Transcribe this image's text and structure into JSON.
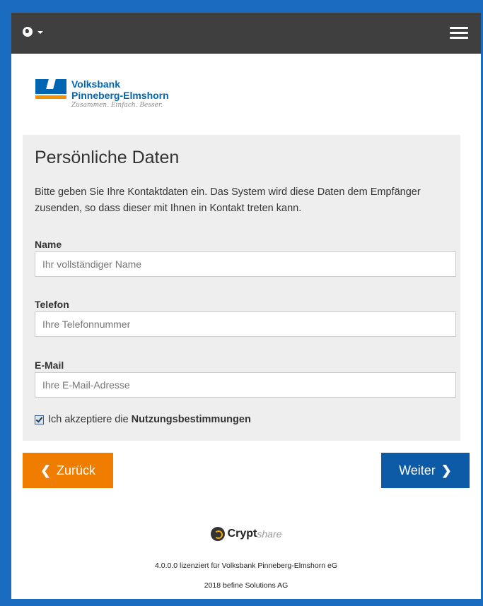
{
  "header": {
    "language_icon": "globe-icon",
    "menu_icon": "hamburger-icon"
  },
  "logo": {
    "line1": "Volksbank",
    "line2": "Pinneberg-Elmshorn",
    "tagline": "Zusammen. Einfach. Besser."
  },
  "form": {
    "title": "Persönliche Daten",
    "intro": "Bitte geben Sie Ihre Kontaktdaten ein. Das System wird diese Daten dem Empfänger zusenden, so dass dieser mit Ihnen in Kontakt treten kann.",
    "name_label": "Name",
    "name_placeholder": "Ihr vollständiger Name",
    "phone_label": "Telefon",
    "phone_placeholder": "Ihre Telefonnummer",
    "email_label": "E-Mail",
    "email_placeholder": "Ihre E-Mail-Adresse",
    "accept_text": "Ich akzeptiere die",
    "accept_link": "Nutzungsbestimmungen",
    "accept_checked": true
  },
  "buttons": {
    "back": "Zurück",
    "next": "Weiter"
  },
  "footer": {
    "brand_bold": "Crypt",
    "brand_light": "share",
    "license": "4.0.0.0 lizenziert für Volksbank Pinneberg-Elmshorn eG",
    "copyright": "2018 befine Solutions AG"
  },
  "colors": {
    "accent_blue": "#0d5aa6",
    "accent_orange": "#f07d00",
    "topbar": "#3f3f3f",
    "frame": "#1a6cc1"
  }
}
